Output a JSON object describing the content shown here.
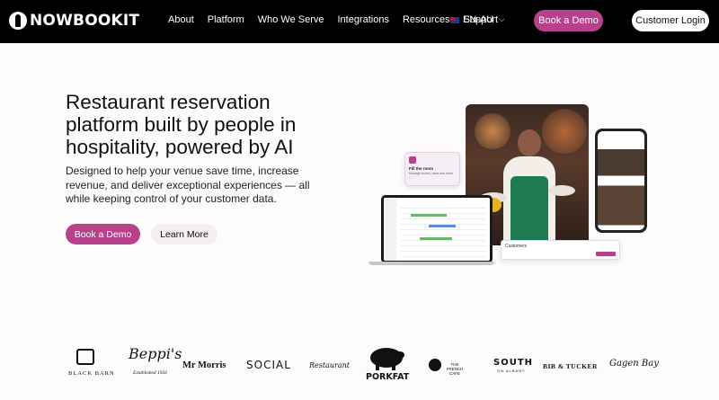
{
  "nav": {
    "brand": "NOWBOOKIT",
    "links": [
      "About",
      "Platform",
      "Who We Serve",
      "Integrations",
      "Resources",
      "Support"
    ],
    "locale": "EN-AU",
    "book_demo": "Book a Demo",
    "customer_login": "Customer Login"
  },
  "hero": {
    "title": "Restaurant reservation platform built by people in hospitality, powered by AI",
    "subtitle": "Designed to help your venue save time, increase revenue, and deliver exceptional experiences — all while keeping control of your customer data.",
    "book_demo": "Book a Demo",
    "learn_more": "Learn More"
  },
  "collage": {
    "notification_title": "Fill the room",
    "notification_text": "Manage covers, save and reset ...",
    "panel_title": "Customers"
  },
  "logos": {
    "black_barn": "BLACK BARN",
    "beppis": "Beppi's",
    "beppis_est": "Established 1956",
    "mr_morris": "Mr Morris",
    "social": "SOCIAL",
    "restaurant": "Restaurant",
    "porkfat": "PORKFAT",
    "french_cafe": "THE FRENCH CAFE",
    "south": "SOUTH",
    "south_sub": "ON ALBANY",
    "bib_tucker": "BIB & TUCKER",
    "gagen_bay": "Gagen Bay"
  }
}
